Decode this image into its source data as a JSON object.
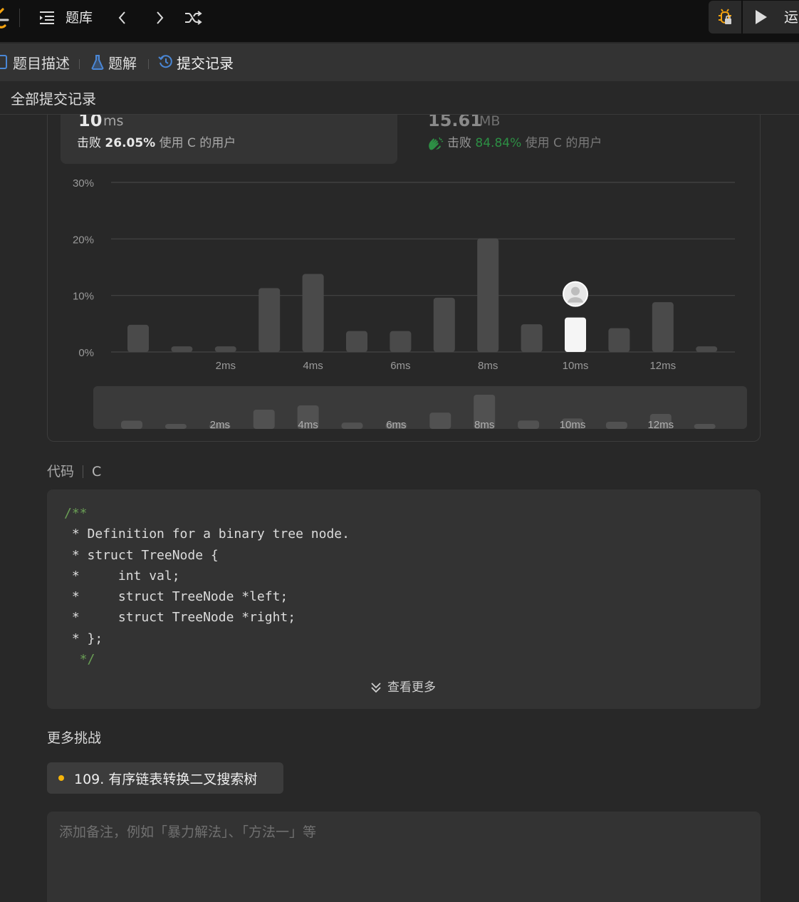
{
  "topbar": {
    "title": "题库",
    "run_label": "运"
  },
  "tabs": [
    {
      "label": "题目描述"
    },
    {
      "label": "题解"
    },
    {
      "label": "提交记录"
    }
  ],
  "subbar": {
    "label": "全部提交记录"
  },
  "runtime": {
    "value": "10",
    "unit": "ms",
    "beat_prefix": "击败",
    "beat_pct": "26.05%",
    "beat_suffix": "使用 C 的用户"
  },
  "memory": {
    "value": "15.61",
    "unit": "MB",
    "beat_prefix": "击败",
    "beat_pct": "84.84%",
    "beat_suffix": "使用 C 的用户"
  },
  "chart_data": {
    "type": "bar",
    "y_ticks": [
      "30%",
      "20%",
      "10%",
      "0%"
    ],
    "ylim": [
      0,
      30
    ],
    "x_tick_labels": [
      "2ms",
      "4ms",
      "6ms",
      "8ms",
      "10ms",
      "12ms"
    ],
    "x": [
      "0ms",
      "1ms",
      "2ms",
      "3ms",
      "4ms",
      "5ms",
      "6ms",
      "7ms",
      "8ms",
      "9ms",
      "10ms",
      "11ms",
      "12ms",
      "13ms"
    ],
    "values": [
      4.8,
      1.0,
      1.0,
      11.3,
      13.8,
      3.7,
      3.7,
      9.6,
      20.1,
      4.9,
      6.1,
      4.2,
      8.8,
      1.0
    ],
    "highlight_index": 10,
    "grid": true,
    "colors": {
      "bar": "#4a4a4a",
      "highlight": "#f5f5f5",
      "grid": "#454545"
    }
  },
  "code": {
    "label": "代码",
    "lang": "C",
    "lines": [
      {
        "text": "/**",
        "comment": true
      },
      {
        "text": " * Definition for a binary tree node.",
        "comment": false
      },
      {
        "text": " * struct TreeNode {",
        "comment": false
      },
      {
        "text": " *     int val;",
        "comment": false
      },
      {
        "text": " *     struct TreeNode *left;",
        "comment": false
      },
      {
        "text": " *     struct TreeNode *right;",
        "comment": false
      },
      {
        "text": " * };",
        "comment": false
      },
      {
        "text": "  */",
        "comment": true
      }
    ],
    "more_label": "查看更多"
  },
  "challenges": {
    "title": "更多挑战",
    "items": [
      {
        "label": "109. 有序链表转换二叉搜索树"
      }
    ]
  },
  "note": {
    "placeholder": "添加备注，例如「暴力解法」、「方法一」等"
  }
}
